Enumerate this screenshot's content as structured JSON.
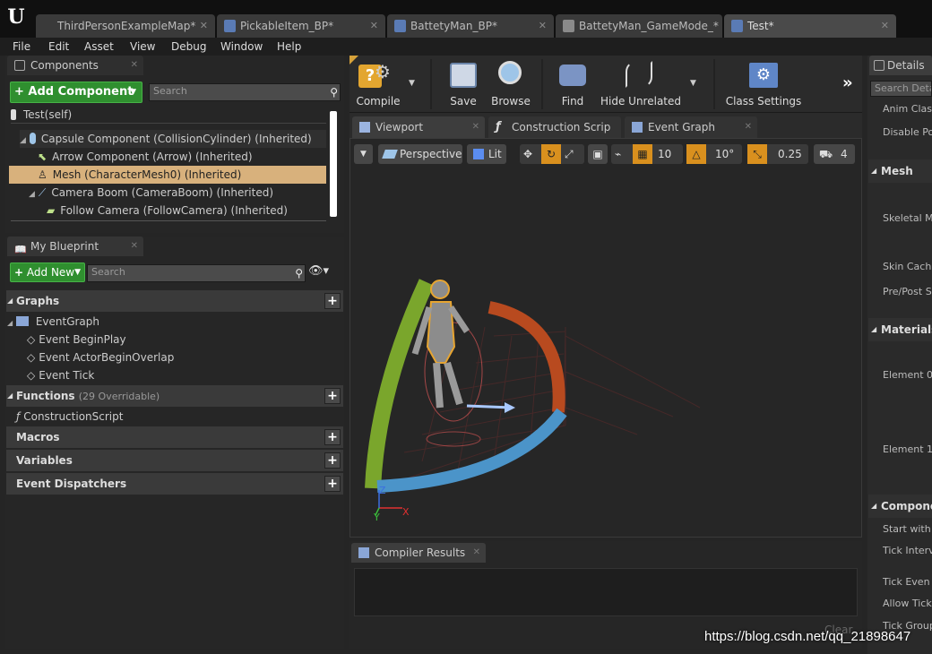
{
  "tabs": [
    {
      "label": "ThirdPersonExampleMap*"
    },
    {
      "label": "PickableItem_BP*"
    },
    {
      "label": "BattetyMan_BP*"
    },
    {
      "label": "BattetyMan_GameMode_*"
    },
    {
      "label": "Test*"
    }
  ],
  "menu": [
    "File",
    "Edit",
    "Asset",
    "View",
    "Debug",
    "Window",
    "Help"
  ],
  "components": {
    "tab_label": "Components",
    "add_button": "+ Add Component",
    "search_placeholder": "Search",
    "tree": [
      "Test(self)",
      "Capsule Component (CollisionCylinder) (Inherited)",
      "Arrow Component (Arrow) (Inherited)",
      "Mesh (CharacterMesh0) (Inherited)",
      "Camera Boom (CameraBoom) (Inherited)",
      "Follow Camera (FollowCamera) (Inherited)"
    ]
  },
  "my_blueprint": {
    "tab_label": "My Blueprint",
    "add_new": "Add New",
    "search_placeholder": "Search",
    "graphs_label": "Graphs",
    "event_graph": "EventGraph",
    "events": [
      "Event BeginPlay",
      "Event ActorBeginOverlap",
      "Event Tick"
    ],
    "functions_label": "Functions",
    "functions_sub": "(29 Overridable)",
    "construction_script": "ConstructionScript",
    "macros_label": "Macros",
    "variables_label": "Variables",
    "dispatchers_label": "Event Dispatchers"
  },
  "toolbar": {
    "compile": "Compile",
    "save": "Save",
    "browse": "Browse",
    "find": "Find",
    "hide_unrelated": "Hide Unrelated",
    "class_settings": "Class Settings"
  },
  "editor_tabs": [
    "Viewport",
    "Construction Scrip",
    "Event Graph"
  ],
  "viewport": {
    "perspective": "Perspective",
    "lit": "Lit",
    "grid_snap": "10",
    "rot_snap": "10°",
    "scale_snap": "0.25",
    "cam_speed": "4"
  },
  "compiler": {
    "tab_label": "Compiler Results",
    "clear": "Clear"
  },
  "details": {
    "tab_label": "Details",
    "search_placeholder": "Search Deta",
    "rows_top": [
      "Anim Class",
      "Disable Pos"
    ],
    "mesh_section": "Mesh",
    "mesh_rows": [
      "Skeletal Mo",
      "Skin Cache",
      "Pre/Post S"
    ],
    "materials_section": "Materials",
    "material_rows": [
      "Element 0",
      "Element 1"
    ],
    "components_section": "Componer",
    "component_rows": [
      "Start with T",
      "Tick Interva",
      "Tick Even v",
      "Allow Tick",
      "Tick Group"
    ]
  },
  "watermark": "https://blog.csdn.net/qq_21898647"
}
